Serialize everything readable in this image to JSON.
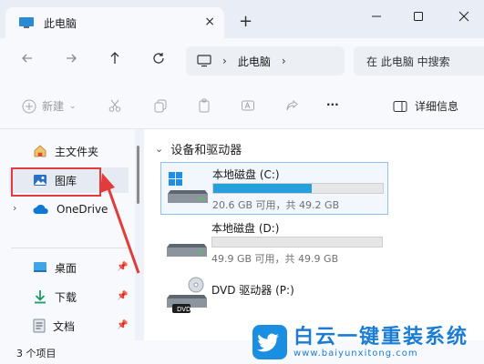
{
  "window": {
    "tab_title": "此电脑",
    "tab_close": "×",
    "new_tab": "+"
  },
  "nav": {
    "address_segments": [
      "此电脑"
    ],
    "search_placeholder": "在 此电脑 中搜索"
  },
  "toolbar": {
    "new_label": "新建",
    "details_label": "详细信息",
    "more_label": "···"
  },
  "sidebar": {
    "items": [
      {
        "label": "主文件夹",
        "icon": "home-icon"
      },
      {
        "label": "图库",
        "icon": "gallery-icon"
      },
      {
        "label": "OneDrive",
        "icon": "onedrive-icon"
      },
      {
        "label": "桌面",
        "icon": "desktop-icon"
      },
      {
        "label": "下载",
        "icon": "download-icon"
      },
      {
        "label": "文档",
        "icon": "document-icon"
      }
    ]
  },
  "content": {
    "group_title": "设备和驱动器",
    "drives": [
      {
        "name": "本地磁盘 (C:)",
        "info": "20.6 GB 可用，共 49.2 GB",
        "used_fraction": 0.58
      },
      {
        "name": "本地磁盘 (D:)",
        "info": "49.9 GB 可用，共 49.9 GB",
        "used_fraction": 0.0
      },
      {
        "name": "DVD 驱动器 (P:)",
        "info": "",
        "badge": "DVD"
      }
    ]
  },
  "status": {
    "item_count": "3 个项目"
  },
  "watermark": {
    "title": "白云一键重装系统",
    "url": "www.baiyunxitong.com"
  },
  "colors": {
    "accent": "#26a0da",
    "highlight": "#e23b3b",
    "brand": "#1a7cd4"
  }
}
